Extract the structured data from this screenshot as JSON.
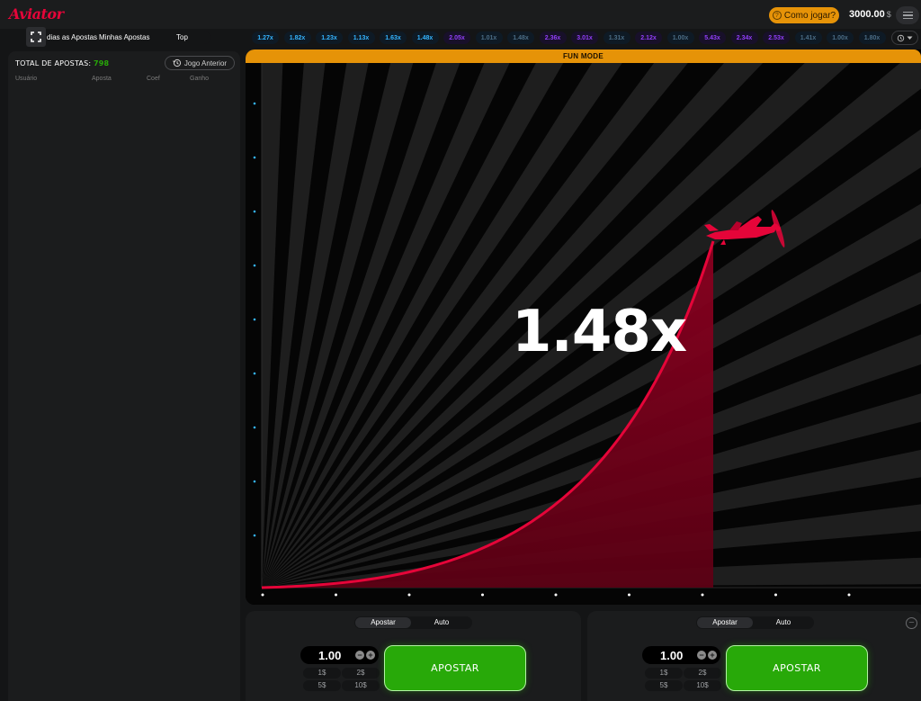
{
  "header": {
    "logo_text": "Aviator",
    "how_to_play": "Como jogar?",
    "balance": "3000.00",
    "currency": "$"
  },
  "left_tabs": [
    "dias as Apostas",
    "Minhas Apostas",
    "Top"
  ],
  "bets_panel": {
    "total_label": "TOTAL DE APOSTAS:",
    "total_count": "798",
    "previous_game_label": "Jogo Anterior",
    "columns": [
      "Usuário",
      "Aposta",
      "Coef",
      "Ganho"
    ]
  },
  "history": [
    {
      "value": "1.27x",
      "tone": "blue"
    },
    {
      "value": "1.82x",
      "tone": "blue"
    },
    {
      "value": "1.23x",
      "tone": "blue"
    },
    {
      "value": "1.13x",
      "tone": "blue"
    },
    {
      "value": "1.63x",
      "tone": "blue"
    },
    {
      "value": "1.48x",
      "tone": "blue"
    },
    {
      "value": "2.05x",
      "tone": "purple"
    },
    {
      "value": "1.01x",
      "tone": "dim"
    },
    {
      "value": "1.48x",
      "tone": "dim"
    },
    {
      "value": "2.36x",
      "tone": "purple"
    },
    {
      "value": "3.01x",
      "tone": "purple"
    },
    {
      "value": "1.31x",
      "tone": "dim"
    },
    {
      "value": "2.12x",
      "tone": "purple"
    },
    {
      "value": "1.00x",
      "tone": "dim"
    },
    {
      "value": "5.43x",
      "tone": "purple"
    },
    {
      "value": "2.34x",
      "tone": "purple"
    },
    {
      "value": "2.53x",
      "tone": "purple"
    },
    {
      "value": "1.41x",
      "tone": "dim"
    },
    {
      "value": "1.00x",
      "tone": "dim"
    },
    {
      "value": "1.80x",
      "tone": "dim"
    }
  ],
  "game": {
    "mode_banner": "FUN MODE",
    "multiplier": "1.48x",
    "plane_icon": "plane-icon",
    "accent_color": "#e50539"
  },
  "bet_panels": [
    {
      "tab_active": "Apostar",
      "tab_other": "Auto",
      "amount": "1.00",
      "quick_amounts": [
        "1$",
        "2$",
        "5$",
        "10$"
      ],
      "button_label": "APOSTAR"
    },
    {
      "tab_active": "Apostar",
      "tab_other": "Auto",
      "amount": "1.00",
      "quick_amounts": [
        "1$",
        "2$",
        "5$",
        "10$"
      ],
      "button_label": "APOSTAR"
    }
  ],
  "colors": {
    "brand_red": "#e50539",
    "bet_green": "#28a909",
    "banner_orange": "#e69308",
    "history_blue": "#34b4ff",
    "history_purple": "#913ef8"
  }
}
